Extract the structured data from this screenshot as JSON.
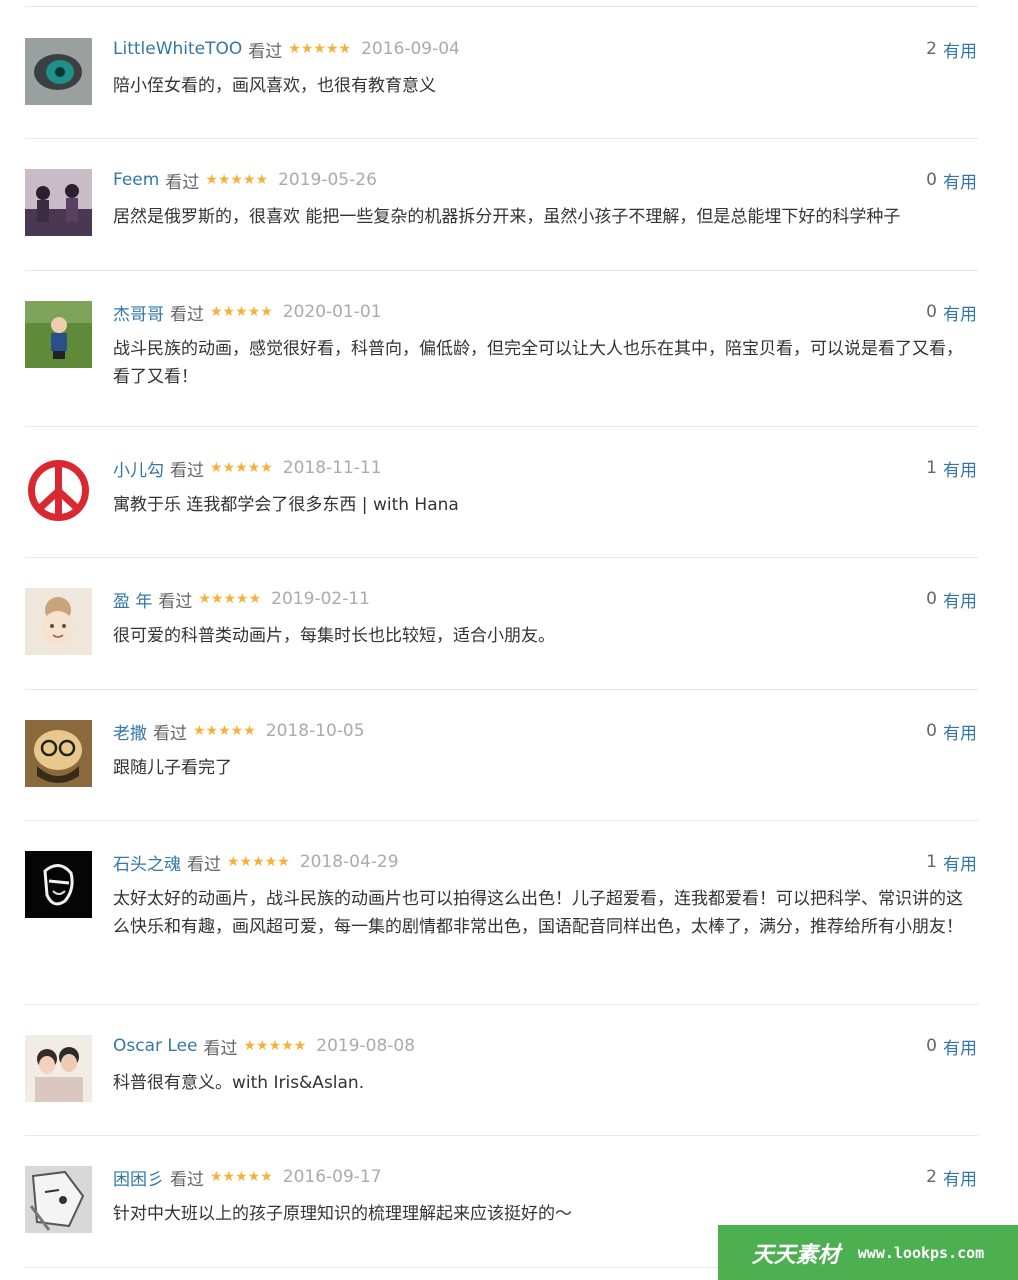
{
  "reviews": [
    {
      "user": "LittleWhiteTOO",
      "watched": "看过",
      "stars": "★★★★★",
      "date": "2016-09-04",
      "useful_count": "2",
      "useful_label": "有用",
      "text": "陪小侄女看的，画风喜欢，也很有教育意义",
      "avatar": "avatar-eye-icon"
    },
    {
      "user": "Feem",
      "watched": "看过",
      "stars": "★★★★★",
      "date": "2019-05-26",
      "useful_count": "0",
      "useful_label": "有用",
      "text": "居然是俄罗斯的，很喜欢 能把一些复杂的机器拆分开来，虽然小孩子不理解，但是总能埋下好的科学种子",
      "avatar": "avatar-group-photo"
    },
    {
      "user": "杰哥哥",
      "watched": "看过",
      "stars": "★★★★★",
      "date": "2020-01-01",
      "useful_count": "0",
      "useful_label": "有用",
      "text": "战斗民族的动画，感觉很好看，科普向，偏低龄，但完全可以让大人也乐在其中，陪宝贝看，可以说是看了又看，看了又看！",
      "avatar": "avatar-child-on-grass"
    },
    {
      "user": "小儿勾",
      "watched": "看过",
      "stars": "★★★★★",
      "date": "2018-11-11",
      "useful_count": "1",
      "useful_label": "有用",
      "text": "寓教于乐 连我都学会了很多东西 | with Hana",
      "avatar": "peace-sign-icon"
    },
    {
      "user": "盈 年",
      "watched": "看过",
      "stars": "★★★★★",
      "date": "2019-02-11",
      "useful_count": "0",
      "useful_label": "有用",
      "text": "很可爱的科普类动画片，每集时长也比较短，适合小朋友。",
      "avatar": "avatar-cartoon-girl"
    },
    {
      "user": "老撒",
      "watched": "看过",
      "stars": "★★★★★",
      "date": "2018-10-05",
      "useful_count": "0",
      "useful_label": "有用",
      "text": "跟随儿子看完了",
      "avatar": "avatar-cartoon-face"
    },
    {
      "user": "石头之魂",
      "watched": "看过",
      "stars": "★★★★★",
      "date": "2018-04-29",
      "useful_count": "1",
      "useful_label": "有用",
      "text": "太好太好的动画片，战斗民族的动画片也可以拍得这么出色！儿子超爱看，连我都爱看！可以把科学、常识讲的这么快乐和有趣，画风超可爱，每一集的剧情都非常出色，国语配音同样出色，太棒了，满分，推荐给所有小朋友！",
      "avatar": "avatar-black-sketch"
    },
    {
      "user": "Oscar Lee",
      "watched": "看过",
      "stars": "★★★★★",
      "date": "2019-08-08",
      "useful_count": "0",
      "useful_label": "有用",
      "text": "科普很有意义。with Iris&Aslan.",
      "avatar": "avatar-couple-photo"
    },
    {
      "user": "困困彡",
      "watched": "看过",
      "stars": "★★★★★",
      "date": "2016-09-17",
      "useful_count": "2",
      "useful_label": "有用",
      "text": "针对中大班以上的孩子原理知识的梳理理解起来应该挺好的～",
      "avatar": "avatar-anime-sketch"
    }
  ],
  "watermark": {
    "logo": "天天素材",
    "url": "www.lookps.com"
  },
  "colors": {
    "username": "#3377aa",
    "stars": "#f7b13a",
    "date": "#aaaaaa",
    "watermark_bg": "#4caf50"
  }
}
